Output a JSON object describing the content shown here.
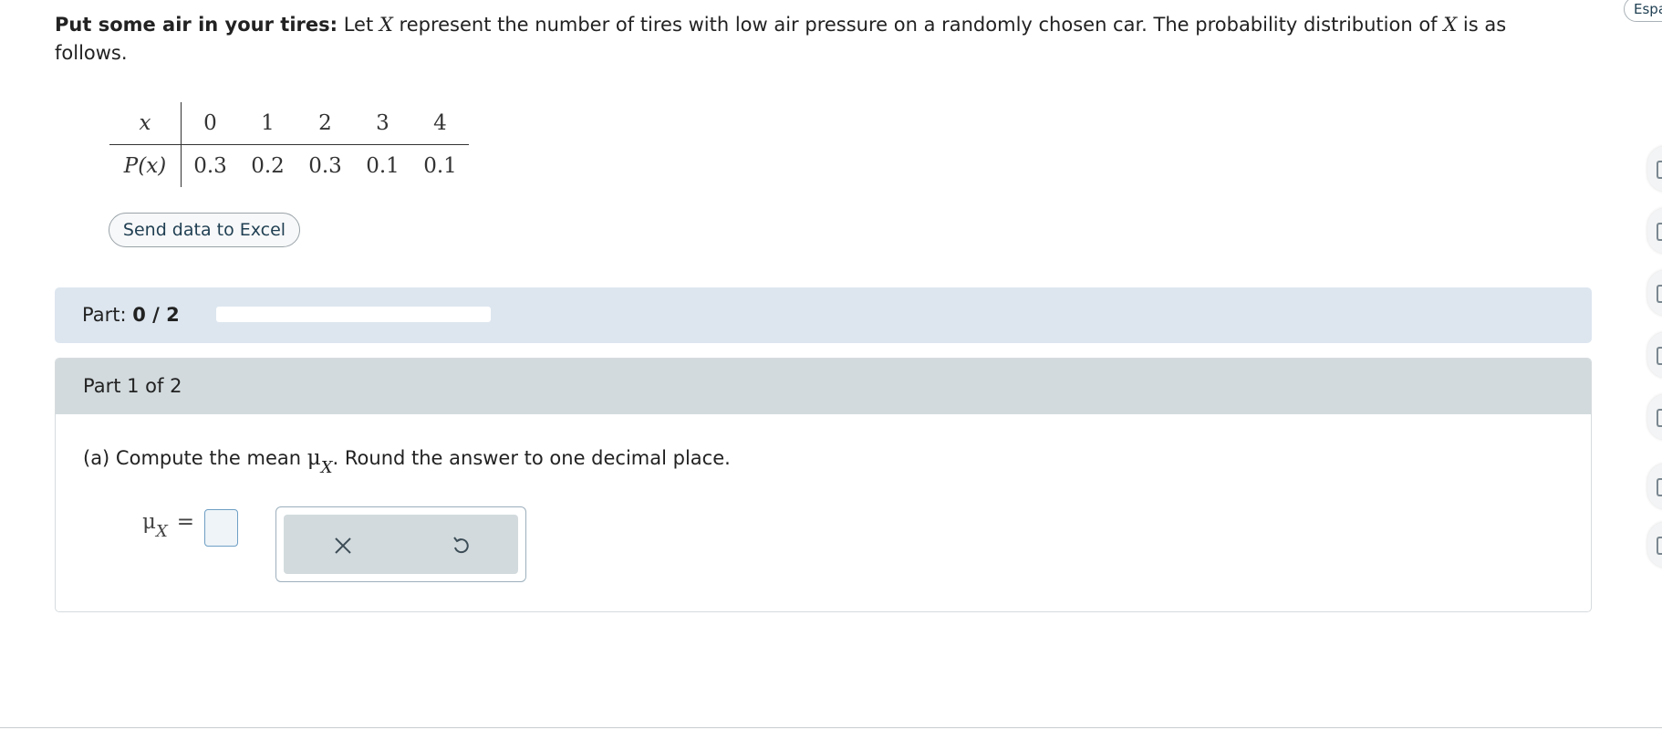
{
  "problem": {
    "bold_lead": "Put some air in your tires:",
    "text_1": "Let",
    "var": "X",
    "text_2": "represent the number of tires with low air pressure on a randomly chosen car. The probability distribution of",
    "var_2": "X",
    "text_3": "is as follows."
  },
  "table": {
    "row_header_x": "x",
    "row_header_p": "P(x)",
    "x_values": [
      "0",
      "1",
      "2",
      "3",
      "4"
    ],
    "p_values": [
      "0.3",
      "0.2",
      "0.3",
      "0.1",
      "0.1"
    ]
  },
  "excel_button": "Send data to Excel",
  "part_progress": {
    "label": "Part:",
    "value": "0 / 2",
    "fraction": 0
  },
  "part": {
    "title": "Part 1 of 2",
    "question_pre": "(a) Compute the mean",
    "mu": "μ",
    "mu_sub": "X",
    "question_post": ". Round the answer to one decimal place.",
    "answer_mu": "μ",
    "answer_sub": "X",
    "equals": "=",
    "answer_value": ""
  },
  "tools": {
    "clear_icon": "close-icon",
    "undo_icon": "undo-icon"
  },
  "sidebar": {
    "language_button": "Espa"
  },
  "colors": {
    "part_bar_bg": "#dde6ef",
    "part_head_bg": "#d2dadd",
    "button_text": "#1f3f52"
  }
}
